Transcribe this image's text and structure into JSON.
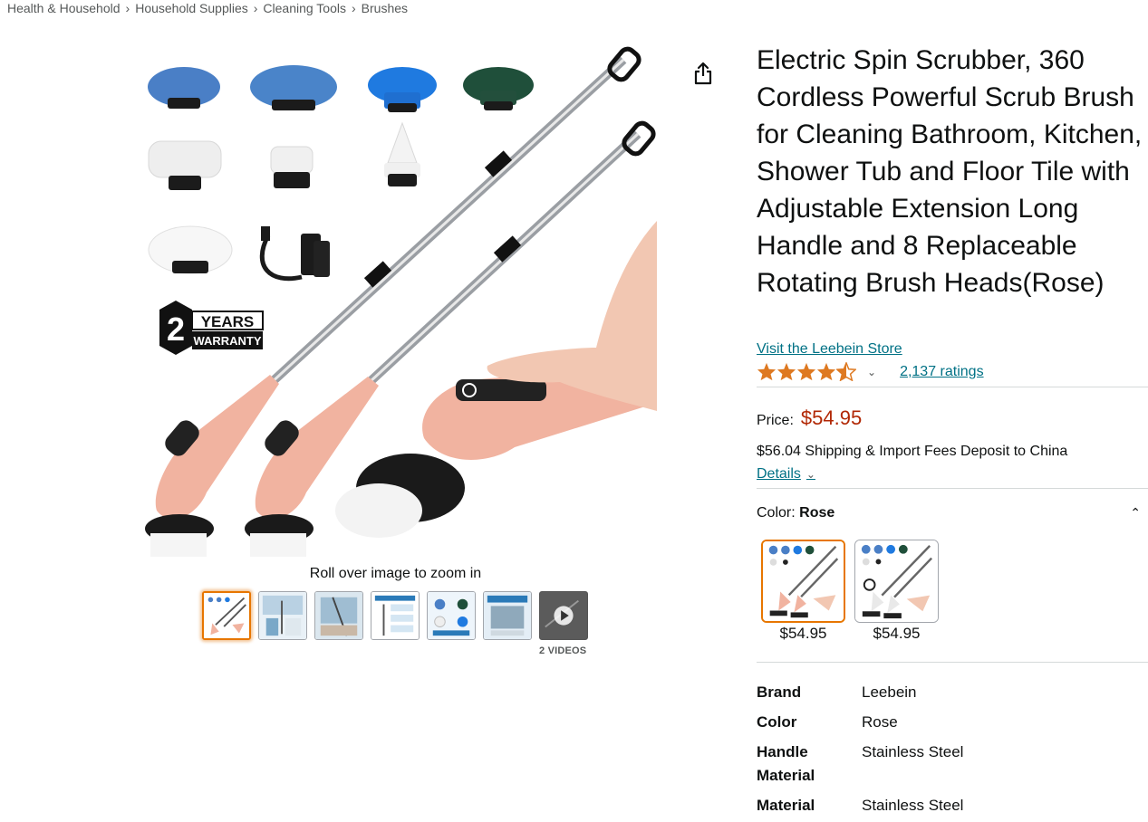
{
  "breadcrumb": [
    "Health & Household",
    "Household Supplies",
    "Cleaning Tools",
    "Brushes"
  ],
  "image_hint": "Roll over image to zoom in",
  "image_badge": {
    "number": "2",
    "line1": "YEARS",
    "line2": "WARRANTY"
  },
  "videos_label": "2 VIDEOS",
  "product": {
    "title": "Electric Spin Scrubber, 360 Cordless Powerful Scrub Brush for Cleaning Bathroom, Kitchen, Shower Tub and Floor Tile with Adjustable Extension Long Handle and 8 Replaceable Rotating Brush Heads(Rose)",
    "store_link": "Visit the Leebein Store",
    "rating_stars": 4.5,
    "ratings_count": "2,137 ratings",
    "price_label": "Price:",
    "price": "$54.95",
    "shipping": "$56.04 Shipping & Import Fees Deposit to China",
    "details_label": "Details",
    "color_label": "Color:",
    "color_value": "Rose"
  },
  "swatches": [
    {
      "price": "$54.95",
      "selected": true
    },
    {
      "price": "$54.95",
      "selected": false
    }
  ],
  "specs": [
    {
      "key": "Brand",
      "value": "Leebein"
    },
    {
      "key": "Color",
      "value": "Rose"
    },
    {
      "key": "Handle Material",
      "value": "Stainless Steel"
    },
    {
      "key": "Material",
      "value": "Stainless Steel"
    }
  ],
  "colors": {
    "link": "#007185",
    "price": "#b12704",
    "selected_border": "#e77600",
    "star": "#de7921"
  },
  "icons": {
    "share": "share-icon",
    "chevron": "chevron-down-icon",
    "collapse": "chevron-up-icon",
    "play": "play-icon",
    "star": "star-icon"
  }
}
